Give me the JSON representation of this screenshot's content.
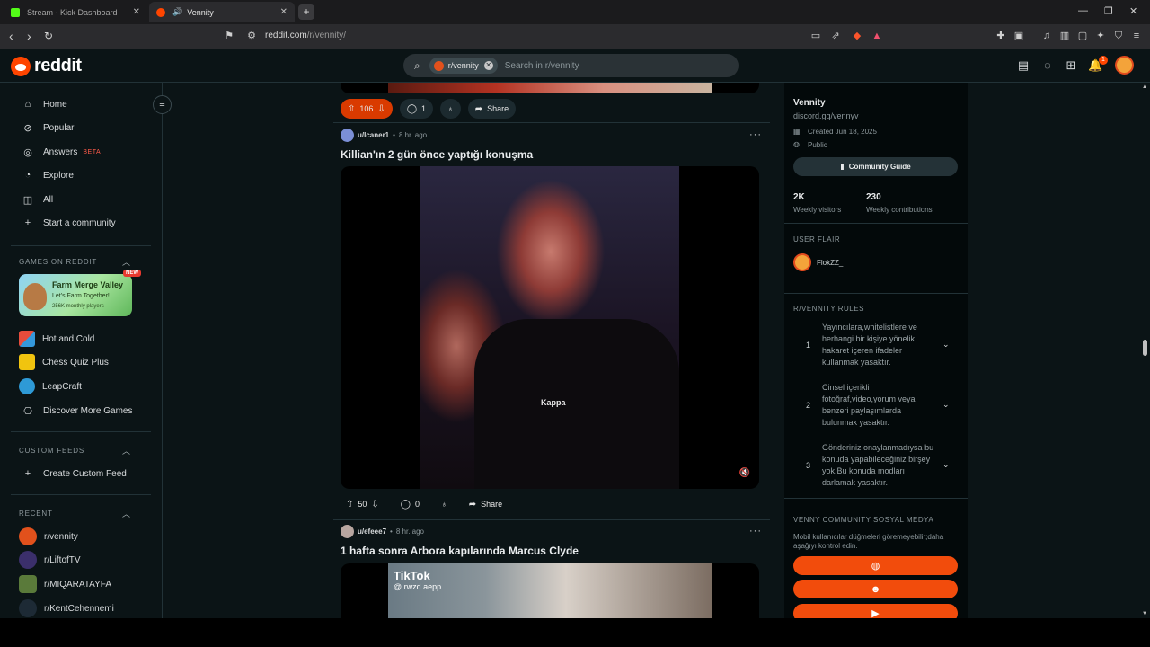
{
  "browser": {
    "tabs": [
      {
        "label": "Stream - Kick Dashboard",
        "favicon_color": "#53fc18"
      },
      {
        "label": "Vennity",
        "favicon_color": "#ff4500",
        "audio_icon": "speaker-icon"
      }
    ],
    "url_host": "reddit.com",
    "url_path": "/r/vennity/"
  },
  "header": {
    "logo_text": "reddit",
    "search_chip": "r/vennity",
    "search_placeholder": "Search in r/vennity",
    "notification_count": "1"
  },
  "sidebar": {
    "nav": [
      {
        "label": "Home",
        "icon": "home-icon"
      },
      {
        "label": "Popular",
        "icon": "popular-icon"
      },
      {
        "label": "Answers",
        "icon": "answers-icon",
        "badge": "BETA"
      },
      {
        "label": "Explore",
        "icon": "explore-icon"
      },
      {
        "label": "All",
        "icon": "all-icon"
      },
      {
        "label": "Start a community",
        "icon": "plus-icon"
      }
    ],
    "games_header": "GAMES ON REDDIT",
    "featured_game": {
      "title": "Farm Merge Valley",
      "subtitle": "Let's Farm Together!",
      "stats": "256K monthly players",
      "badge": "NEW"
    },
    "games": [
      {
        "label": "Hot and Cold"
      },
      {
        "label": "Chess Quiz Plus"
      },
      {
        "label": "LeapCraft"
      },
      {
        "label": "Discover More Games"
      }
    ],
    "custom_feeds_header": "CUSTOM FEEDS",
    "create_custom_feed": "Create Custom Feed",
    "recent_header": "RECENT",
    "recent": [
      {
        "label": "r/vennity",
        "color": "#e2511c"
      },
      {
        "label": "r/LiftofTV",
        "color": "#3b2f6b"
      },
      {
        "label": "r/MIQARATAYFA",
        "color": "#5a7a3a"
      },
      {
        "label": "r/KentCehennemi",
        "color": "#1d2a35"
      }
    ]
  },
  "feed": {
    "prev_post_actions": {
      "votes": "106",
      "comments": "1",
      "share": "Share"
    },
    "posts": [
      {
        "user": "u/Icaner1",
        "time": "8 hr. ago",
        "title": "Killian'ın 2 gün önce yaptığı konuşma",
        "video_brand": "Kappa",
        "votes": "50",
        "comments": "0",
        "share": "Share"
      },
      {
        "user": "u/efeee7",
        "time": "8 hr. ago",
        "title": "1 hafta sonra Arbora kapılarında Marcus Clyde",
        "video_watermark": "TikTok",
        "video_handle": "@ rwzd.aepp"
      }
    ]
  },
  "community": {
    "name": "Vennity",
    "description": "discord.gg/vennyv",
    "created": "Created Jun 18, 2025",
    "visibility": "Public",
    "guide_button": "Community Guide",
    "stats": [
      {
        "value": "2K",
        "label": "Weekly visitors"
      },
      {
        "value": "230",
        "label": "Weekly contributions"
      }
    ],
    "user_flair_header": "USER FLAIR",
    "user_flair": "FlokZZ_",
    "rules_header": "R/VENNITY RULES",
    "rules": [
      {
        "num": "1",
        "text": "Yayıncılara,whitelistlere ve herhangi bir kişiye yönelik hakaret içeren ifadeler kullanmak yasaktır."
      },
      {
        "num": "2",
        "text": "Cinsel içerikli fotoğraf,video,yorum veya benzeri paylaşımlarda bulunmak yasaktır."
      },
      {
        "num": "3",
        "text": "Gönderiniz onaylanmadıysa bu konuda yapabileceğiniz birşey yok.Bu konuda modları darlamak yasaktır."
      }
    ],
    "social_header": "VENNY COMMUNITY SOSYAL MEDYA",
    "social_note": "Mobil kullanıcılar düğmeleri göremeyebilir;daha aşağıyı kontrol edin.",
    "social_buttons": [
      {
        "icon": "globe-icon"
      },
      {
        "icon": "discord-icon"
      },
      {
        "icon": "youtube-icon"
      }
    ]
  }
}
